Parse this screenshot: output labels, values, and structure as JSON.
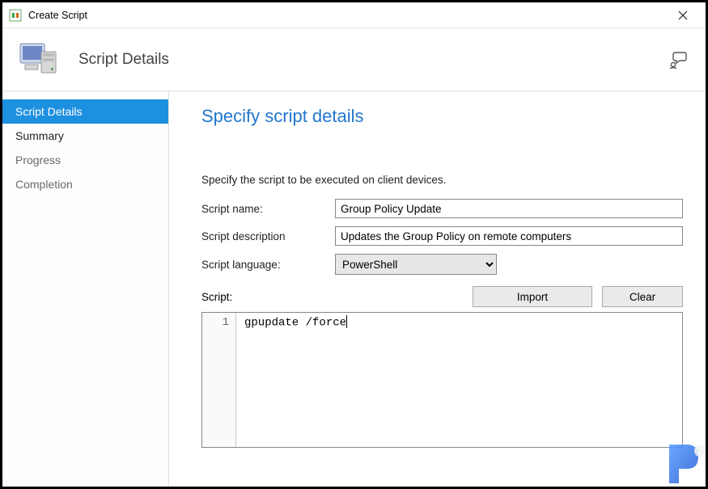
{
  "window": {
    "title": "Create Script"
  },
  "header": {
    "heading": "Script Details"
  },
  "sidebar": {
    "items": [
      {
        "label": "Script Details",
        "selected": true
      },
      {
        "label": "Summary"
      },
      {
        "label": "Progress"
      },
      {
        "label": "Completion"
      }
    ]
  },
  "content": {
    "page_title": "Specify script details",
    "instruction": "Specify the script to be executed on client devices.",
    "labels": {
      "name": "Script name:",
      "description": "Script description",
      "language": "Script language:",
      "script": "Script:"
    },
    "fields": {
      "name": "Group Policy Update",
      "description": "Updates the Group Policy on remote computers",
      "language": "PowerShell"
    },
    "buttons": {
      "import": "Import",
      "clear": "Clear"
    },
    "editor": {
      "line_number": "1",
      "code": "gpupdate /force"
    }
  }
}
